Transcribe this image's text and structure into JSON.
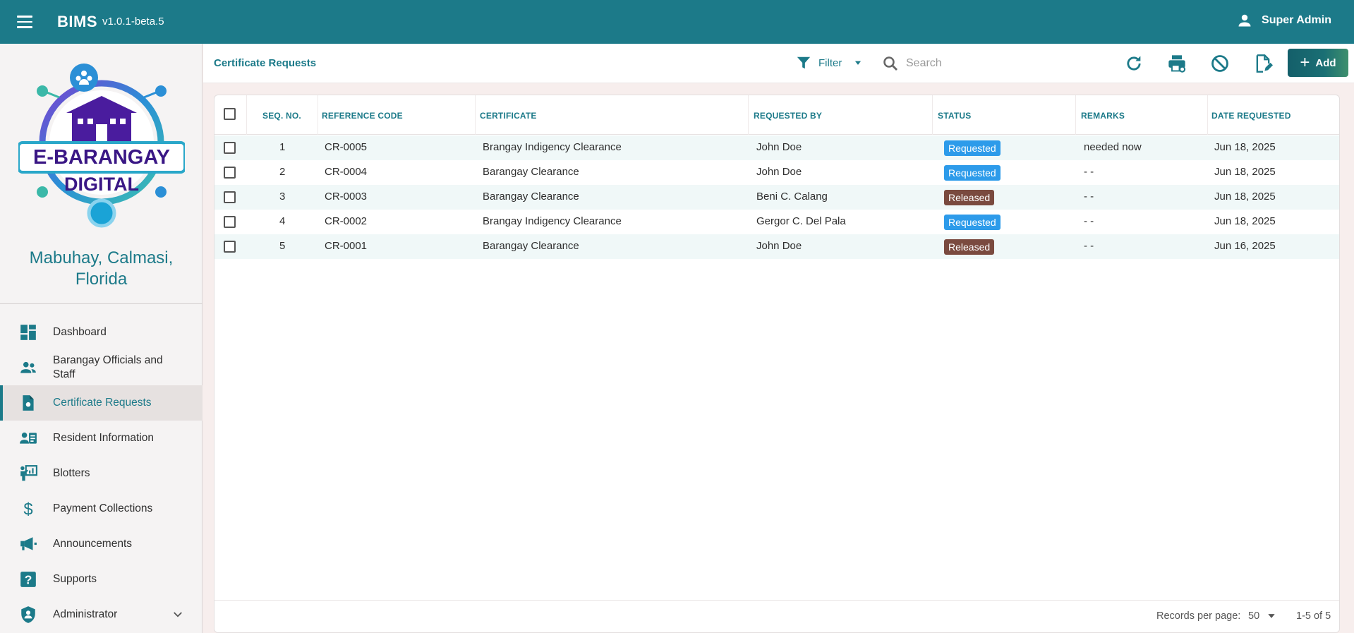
{
  "app": {
    "name": "BIMS",
    "version": "v1.0.1-beta.5",
    "user": "Super Admin"
  },
  "sidebar": {
    "logo_text_1": "E-BARANGAY",
    "logo_text_2": "DIGITAL",
    "barangay_line1": "Mabuhay, Calmasi,",
    "barangay_line2": "Florida",
    "items": [
      {
        "label": "Dashboard",
        "icon": "dashboard-icon"
      },
      {
        "label": "Barangay Officials and Staff",
        "icon": "people-icon"
      },
      {
        "label": "Certificate Requests",
        "icon": "certificate-icon",
        "active": true
      },
      {
        "label": "Resident Information",
        "icon": "resident-icon"
      },
      {
        "label": "Blotters",
        "icon": "presentation-icon"
      },
      {
        "label": "Payment Collections",
        "icon": "dollar-icon"
      },
      {
        "label": "Announcements",
        "icon": "megaphone-icon"
      },
      {
        "label": "Supports",
        "icon": "help-icon"
      },
      {
        "label": "Administrator",
        "icon": "shield-icon"
      }
    ]
  },
  "header": {
    "title": "Certificate Requests",
    "filter_label": "Filter",
    "search_placeholder": "Search",
    "add_label": "Add"
  },
  "table": {
    "columns": [
      "SEQ. NO.",
      "REFERENCE CODE",
      "CERTIFICATE",
      "REQUESTED BY",
      "STATUS",
      "REMARKS",
      "DATE REQUESTED"
    ],
    "rows": [
      {
        "seq": "1",
        "ref": "CR-0005",
        "certificate": "Brangay Indigency Clearance",
        "requested_by": "John Doe",
        "status": "Requested",
        "remarks": "needed now",
        "date": "Jun 18, 2025"
      },
      {
        "seq": "2",
        "ref": "CR-0004",
        "certificate": "Barangay Clearance",
        "requested_by": "John Doe",
        "status": "Requested",
        "remarks": "- -",
        "date": "Jun 18, 2025"
      },
      {
        "seq": "3",
        "ref": "CR-0003",
        "certificate": "Barangay Clearance",
        "requested_by": "Beni C. Calang",
        "status": "Released",
        "remarks": "- -",
        "date": "Jun 18, 2025"
      },
      {
        "seq": "4",
        "ref": "CR-0002",
        "certificate": "Brangay Indigency Clearance",
        "requested_by": "Gergor C. Del Pala",
        "status": "Requested",
        "remarks": "- -",
        "date": "Jun 18, 2025"
      },
      {
        "seq": "5",
        "ref": "CR-0001",
        "certificate": "Barangay Clearance",
        "requested_by": "John Doe",
        "status": "Released",
        "remarks": "- -",
        "date": "Jun 16, 2025"
      }
    ]
  },
  "footer": {
    "records_per_page_label": "Records per page:",
    "records_per_page": "50",
    "range": "1-5 of 5"
  },
  "colors": {
    "primary": "#1c7a89",
    "requested": "#2d9bea",
    "released": "#7a4a3f"
  }
}
